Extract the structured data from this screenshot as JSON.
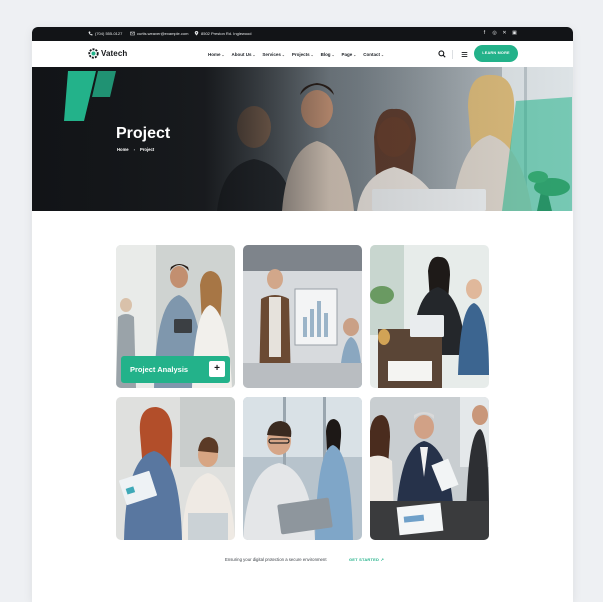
{
  "topbar": {
    "phone": "(704) 555-0127",
    "email": "curtis.weaver@example.com",
    "address": "8502 Preston Rd. Inglewood",
    "social_icons": [
      "facebook-icon",
      "instagram-icon",
      "x-twitter-icon",
      "linkedin-icon"
    ]
  },
  "nav": {
    "logo_text": "Vatech",
    "menu": [
      {
        "label": "Home",
        "has_dropdown": true
      },
      {
        "label": "About Us",
        "has_dropdown": true
      },
      {
        "label": "Services",
        "has_dropdown": true
      },
      {
        "label": "Projects",
        "has_dropdown": true
      },
      {
        "label": "Blog",
        "has_dropdown": true
      },
      {
        "label": "Page",
        "has_dropdown": true
      },
      {
        "label": "Contact",
        "has_dropdown": true
      }
    ],
    "cta_label": "LEARN MORE"
  },
  "hero": {
    "title": "Project",
    "breadcrumb": [
      "Home",
      "Project"
    ]
  },
  "projects": [
    {
      "overlay_title": "Project Analysis",
      "overlay_action": "+"
    },
    {},
    {},
    {},
    {},
    {}
  ],
  "footer": {
    "text": "Ensuring your digital protection a secure environment",
    "link_label": "GET STARTED"
  },
  "colors": {
    "accent": "#23b28a",
    "dark": "#121417",
    "page_background": "#eef0f3"
  }
}
